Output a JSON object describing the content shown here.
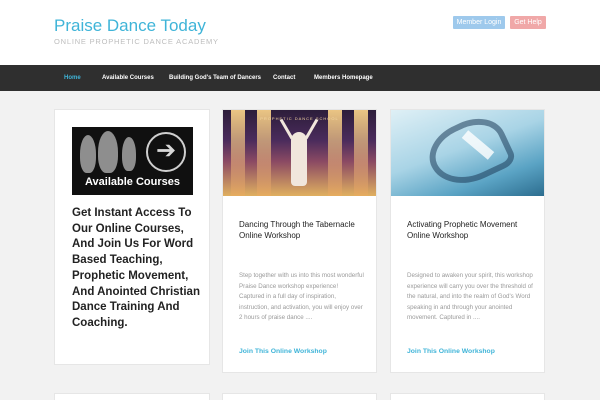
{
  "site": {
    "title": "Praise Dance Today",
    "tagline": "ONLINE PROPHETIC DANCE ACADEMY"
  },
  "header_buttons": {
    "login": "Member Login",
    "help": "Get Help"
  },
  "nav": {
    "items": [
      {
        "label": "Home",
        "active": true
      },
      {
        "label": "Available Courses",
        "active": false
      },
      {
        "label": "Building God's Team of Dancers",
        "active": false
      },
      {
        "label": "Contact",
        "active": false
      },
      {
        "label": "Members Homepage",
        "active": false
      }
    ]
  },
  "promo": {
    "banner_text": "Available Courses",
    "heading": "Get Instant Access To Our Online Courses, And Join Us For Word Based Teaching, Prophetic Movement, And Anointed Christian Dance Training And Coaching."
  },
  "courses": [
    {
      "image_label": "PROPHETIC DANCE SCHOOL",
      "title": "Dancing Through the Tabernacle Online Workshop",
      "description": "Step together with us into this most wonderful Praise Dance workshop experience! Captured in a full day of inspiration, instruction, and activation, you will enjoy over 2 hours of praise dance ....",
      "link": "Join This Online Workshop"
    },
    {
      "title": "Activating Prophetic Movement Online Workshop",
      "description": "Designed to awaken your spirit, this workshop experience will carry you over the threshold of the natural, and into the realm of God's Word speaking in and through your anointed movement. Captured in ....",
      "link": "Join This Online Workshop"
    }
  ],
  "colors": {
    "accent": "#3fb4d8",
    "nav_bg": "#2f2f2f",
    "login_button": "#9ec9ec",
    "help_button": "#f0a8a8",
    "page_bg": "#f2f2f2"
  }
}
